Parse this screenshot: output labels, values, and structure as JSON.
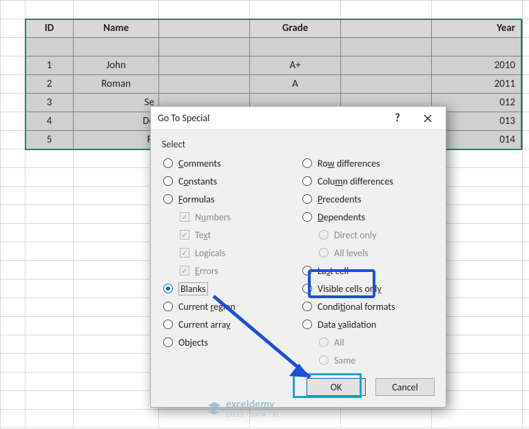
{
  "table": {
    "headers": {
      "id": "ID",
      "name": "Name",
      "grade": "Grade",
      "year": "Year"
    },
    "rows": [
      {
        "id": "1",
        "name": "John",
        "grade": "A+",
        "year": "2010"
      },
      {
        "id": "2",
        "name": "Roman",
        "grade": "A",
        "year": "2011"
      },
      {
        "id": "3",
        "name": "Se",
        "grade": "",
        "year": "012"
      },
      {
        "id": "4",
        "name": "De",
        "grade": "",
        "year": "013"
      },
      {
        "id": "5",
        "name": "Fi",
        "grade": "",
        "year": "014"
      }
    ]
  },
  "dialog": {
    "title": "Go To Special",
    "section": "Select",
    "left": {
      "comments": "omments",
      "constants": "nstants",
      "formulas": "ormulas",
      "numbers": "mbers",
      "text": "Te",
      "logicals": "Logicals",
      "errors": "rrors",
      "blanks": "lanks",
      "cur_region": "Current ",
      "cur_array": "Current arra",
      "objects": "bjects"
    },
    "right": {
      "row_diff": " differences",
      "col_diff": "Colu",
      "precedents": "recedents",
      "dependents": "ependents",
      "direct": "Direct only",
      "all_levels": "All levels",
      "last_cell": "La",
      "visible": "Visible cells onl",
      "cond_fmt": "Condi",
      "data_val": "Data ",
      "all": "All",
      "same": "Same"
    },
    "buttons": {
      "ok": "OK",
      "cancel": "Cancel"
    }
  },
  "watermark": {
    "brand": "exceldemy",
    "tagline": "EXCEL · DATA · BI"
  }
}
